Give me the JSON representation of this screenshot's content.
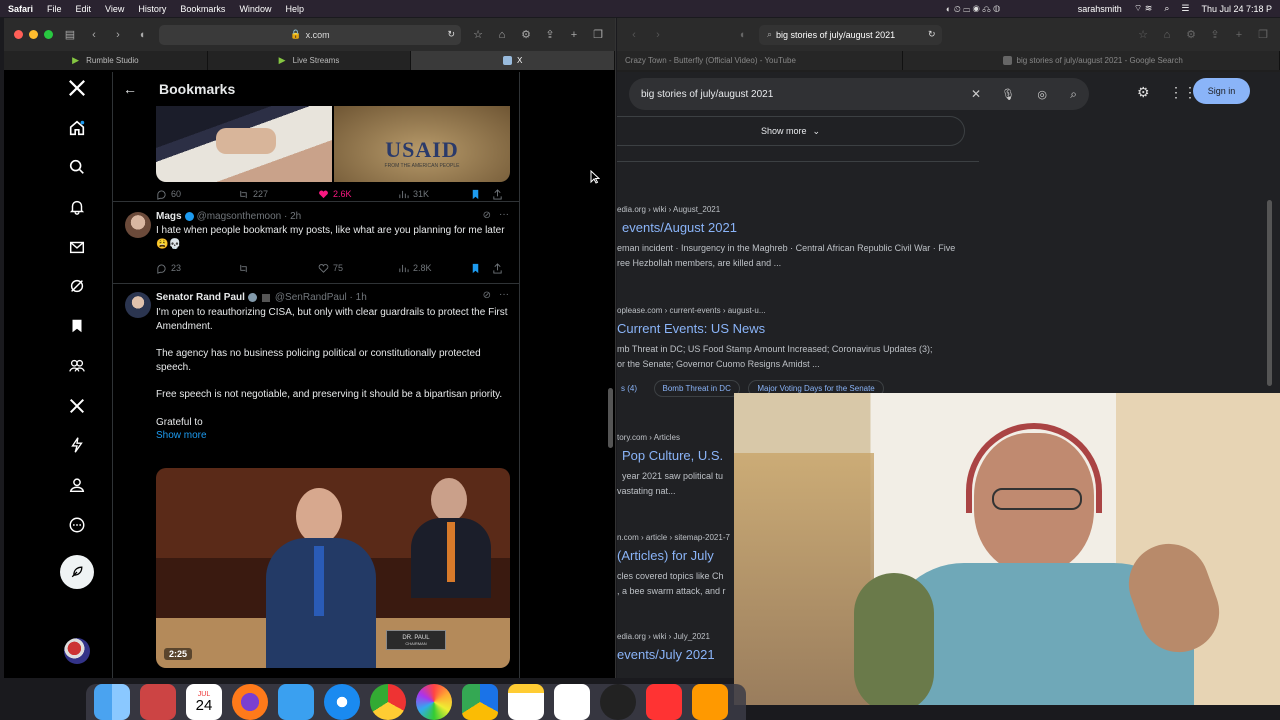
{
  "menubar": {
    "items": [
      "Safari",
      "File",
      "Edit",
      "View",
      "History",
      "Bookmarks",
      "Window",
      "Help"
    ],
    "user": "sarahsmith",
    "clock": "Thu Jul 24  7:18 P"
  },
  "left_browser": {
    "address": "x.com",
    "tabs": [
      {
        "label": "Rumble Studio",
        "color": "#85c742"
      },
      {
        "label": "Live Streams",
        "color": "#85c742"
      },
      {
        "label": "X",
        "color": "#9bd"
      }
    ]
  },
  "x": {
    "header": "Bookmarks",
    "tweet1": {
      "image_text": "USAID",
      "image_subtext": "FROM THE AMERICAN PEOPLE",
      "replies": "60",
      "reposts": "227",
      "likes": "2.6K",
      "views": "31K"
    },
    "tweet2": {
      "name": "Mags",
      "handle": "@magsonthemoon · 2h",
      "text": "I hate when people bookmark my posts, like what are you planning for me later 😩💀",
      "replies": "23",
      "likes": "75",
      "views": "2.8K"
    },
    "tweet3": {
      "name": "Senator Rand Paul",
      "handle": "@SenRandPaul · 1h",
      "p1": "I'm open to reauthorizing CISA, but only with clear guardrails to protect the First Amendment.",
      "p2": "The agency has no business policing political or constitutionally protected speech.",
      "p3": "Free speech is not negotiable, and preserving it should be a bipartisan priority.",
      "p4": "Grateful to",
      "show_more": "Show more",
      "video_time": "2:25",
      "nameplate": "DR. PAUL",
      "nameplate_sub": "CHAIRMAN"
    }
  },
  "right_browser": {
    "address": "big stories of july/august 2021",
    "tabs": [
      {
        "label": "Crazy Town - Butterfly (Official Video) - YouTube"
      },
      {
        "label": "big stories of july/august 2021 - Google Search"
      }
    ],
    "search_value": "big stories of july/august 2021",
    "sign_in": "Sign in",
    "show_more": "Show more",
    "results": [
      {
        "site": "edia.org › wiki › August_2021",
        "title": "events/August 2021",
        "s1": "eman incident · Insurgency in the Maghreb · Central African Republic Civil War · Five",
        "s2": "ree Hezbollah members, are killed and ..."
      },
      {
        "site": "oplease.com › current-events › august-u...",
        "title": "Current Events: US News",
        "s1": "mb Threat in DC; US Food Stamp Amount Increased; Coronavirus Updates (3);",
        "s2": "or the Senate; Governor Cuomo Resigns Amidst ..."
      },
      {
        "site": "tory.com › Articles",
        "title": "Pop Culture, U.S.",
        "s1": "year 2021 saw political tu",
        "s2": "vastating nat..."
      },
      {
        "site": "n.com › article › sitemap-2021-7",
        "title": "(Articles) for July",
        "s1": "cles covered topics like Ch",
        "s2": ", a bee swarm attack, and r"
      },
      {
        "site": "edia.org › wiki › July_2021",
        "title": "events/July 2021",
        "s1": "",
        "s2": ""
      }
    ],
    "chips": [
      "s (4)",
      "Bomb Threat in DC",
      "Major Voting Days for the Senate"
    ]
  },
  "dock": {
    "calendar_month": "JUL",
    "calendar_day": "24"
  }
}
